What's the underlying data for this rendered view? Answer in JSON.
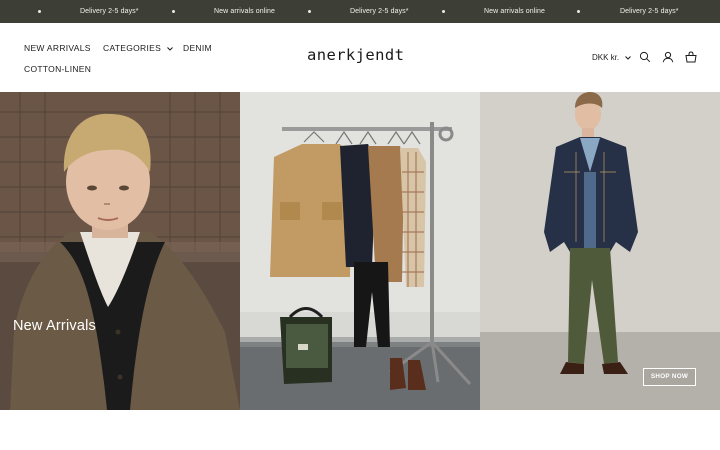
{
  "announcement": {
    "items": [
      "Delivery 2-5 days*",
      "New arrivals online",
      "Delivery 2-5 days*",
      "New arrivals online",
      "Delivery 2-5 days*"
    ]
  },
  "nav": {
    "new_arrivals": "NEW ARRIVALS",
    "categories": "CATEGORIES",
    "denim": "DENIM",
    "cotton_linen": "COTTON-LINEN"
  },
  "logo": "anerkjendt",
  "currency": "DKK kr.",
  "hero": {
    "title": "New Arrivals",
    "cta": "SHOP NOW"
  },
  "colors": {
    "announcement_bg": "#3d3f37",
    "text": "#1c1c1c",
    "background": "#ffffff"
  }
}
